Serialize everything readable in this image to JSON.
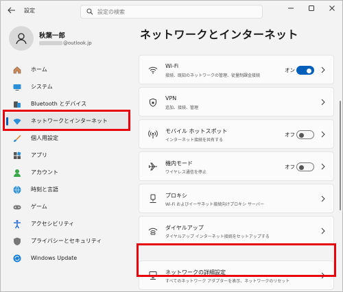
{
  "window": {
    "title": "設定",
    "search_placeholder": "設定の検索"
  },
  "profile": {
    "name": "秋葉一郎",
    "email_suffix": "@outlook.jp"
  },
  "sidebar": {
    "items": [
      {
        "label": "ホーム",
        "icon": "home-icon"
      },
      {
        "label": "システム",
        "icon": "system-icon"
      },
      {
        "label": "Bluetooth とデバイス",
        "icon": "bluetooth-icon"
      },
      {
        "label": "ネットワークとインターネット",
        "icon": "network-icon",
        "active": true
      },
      {
        "label": "個人用設定",
        "icon": "brush-icon"
      },
      {
        "label": "アプリ",
        "icon": "apps-icon"
      },
      {
        "label": "アカウント",
        "icon": "account-icon"
      },
      {
        "label": "時刻と言語",
        "icon": "globe-icon"
      },
      {
        "label": "ゲーム",
        "icon": "game-icon"
      },
      {
        "label": "アクセシビリティ",
        "icon": "accessibility-icon"
      },
      {
        "label": "プライバシーとセキュリティ",
        "icon": "shield-icon"
      },
      {
        "label": "Windows Update",
        "icon": "update-icon"
      }
    ]
  },
  "main": {
    "title": "ネットワークとインターネット",
    "cards": [
      {
        "title": "Wi-Fi",
        "subtitle": "接続、既知のネットワークの管理、従量制課金接続",
        "toggle": "オン",
        "icon": "wifi-icon"
      },
      {
        "title": "VPN",
        "subtitle": "追加、接続、管理",
        "icon": "vpn-shield-icon"
      },
      {
        "title": "モバイル ホットスポット",
        "subtitle": "インターネット接続を共有する",
        "toggle": "オフ",
        "icon": "hotspot-icon"
      },
      {
        "title": "機内モード",
        "subtitle": "ワイヤレス通信を停止",
        "toggle": "オフ",
        "icon": "airplane-icon"
      },
      {
        "title": "プロキシ",
        "subtitle": "Wi-Fi およびイーサネット接続向けプロキシ サーバー",
        "icon": "proxy-icon"
      },
      {
        "title": "ダイヤルアップ",
        "subtitle": "ダイヤルアップ インターネット接続をセットアップする",
        "icon": "dialup-icon"
      },
      {
        "title": "ネットワークの詳細設定",
        "subtitle": "すべてのネットワーク アダプターを表示、ネットワークのリセット",
        "icon": "network-pc-icon"
      }
    ]
  },
  "colors": {
    "accent": "#005fb8",
    "highlight": "#e8000b"
  }
}
